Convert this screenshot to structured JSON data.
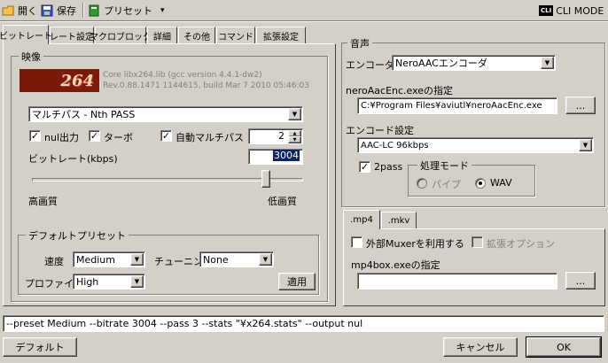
{
  "toolbar": {
    "open": "開く",
    "save": "保存",
    "preset": "プリセット",
    "preset_arrow": "▾",
    "cli_badge": "CLI",
    "cli_mode": "CLI MODE"
  },
  "video_tabs": [
    "ビットレート",
    "レート設定",
    "マクロブロック",
    "詳細",
    "その他",
    "コマンド",
    "拡張設定"
  ],
  "video": {
    "group_title": "映像",
    "logo_text": "264",
    "core_line1": "Core libx264.lib (gcc version 4.4.1-dw2)",
    "core_line2": "Rev.0.88.1471 1144615, build Mar  7 2010 05:46:03",
    "mode_value": "マルチパス - Nth PASS",
    "nul_label": "nul出力",
    "nul_checked": "✓",
    "turbo_label": "ターボ",
    "turbo_checked": "✓",
    "auto_multipass_label": "自動マルチパス",
    "auto_multipass_checked": "✓",
    "pass_count": "2",
    "bitrate_label": "ビットレート(kbps)",
    "bitrate_value": "3004",
    "slider_fraction": 0.875,
    "quality_high": "高画質",
    "quality_low": "低画質"
  },
  "default_preset": {
    "group_title": "デフォルトプリセット",
    "speed_label": "速度",
    "speed_value": "Medium",
    "tuning_label": "チューニング",
    "tuning_value": "None",
    "profile_label": "プロファイル",
    "profile_value": "High",
    "apply": "適用"
  },
  "audio": {
    "group_title": "音声",
    "encoder_label": "エンコーダ",
    "encoder_value": "NeroAACエンコーダ",
    "path_label": "neroAacEnc.exeの指定",
    "path_value": "C:¥Program Files¥aviutl¥neroAacEnc.exe",
    "browse": "...",
    "settings_label": "エンコード設定",
    "settings_value": "AAC-LC 96kbps",
    "twopass_label": "2pass",
    "twopass_checked": "✓",
    "proc_mode_title": "処理モード",
    "pipe_label": "パイプ",
    "wav_label": "WAV"
  },
  "mux_tabs": [
    ".mp4",
    ".mkv"
  ],
  "mux": {
    "external_label": "外部Muxerを利用する",
    "extension_label": "拡張オプション",
    "mp4box_label": "mp4box.exeの指定",
    "mp4box_value": "",
    "browse": "..."
  },
  "cmdline": "--preset Medium --bitrate 3004 --pass 3 --stats \"¥x264.stats\" --output nul",
  "footer": {
    "default": "デフォルト",
    "cancel": "キャンセル",
    "ok": "OK"
  },
  "colors": {
    "logo_red": "#c83010",
    "logo_bg": "#7a1a08",
    "titlebar": "#0a246a"
  }
}
